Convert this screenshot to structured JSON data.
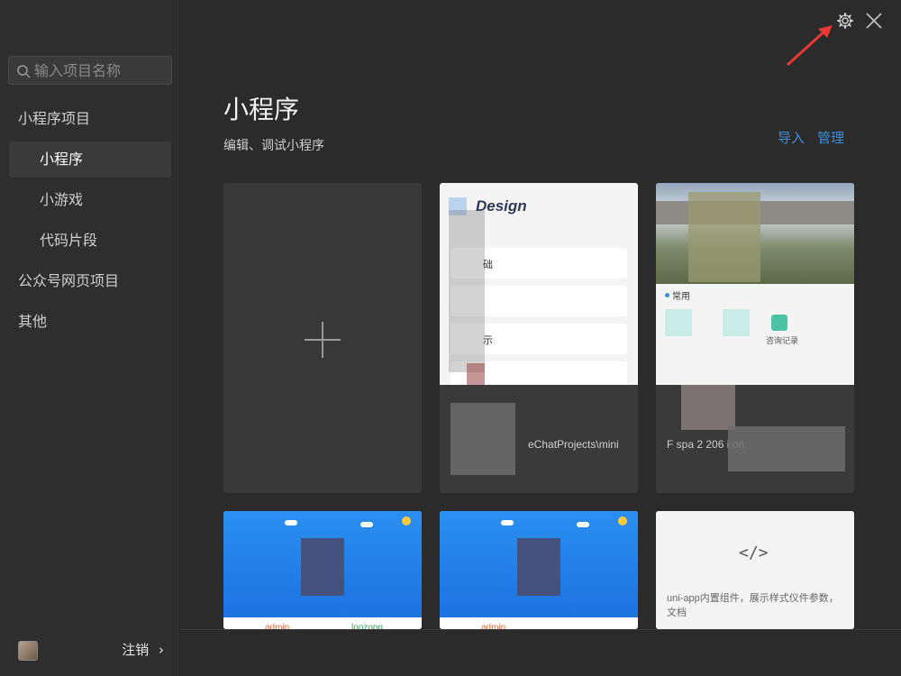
{
  "sidebar": {
    "search_placeholder": "输入项目名称",
    "items": [
      {
        "label": "小程序项目"
      },
      {
        "label": "小程序"
      },
      {
        "label": "小游戏"
      },
      {
        "label": "代码片段"
      },
      {
        "label": "公众号网页项目"
      },
      {
        "label": "其他"
      }
    ],
    "footer": {
      "logout_label": "注销",
      "chevron": "›"
    }
  },
  "main": {
    "title": "小程序",
    "subtitle": "编辑、调试小程序",
    "actions": {
      "import_label": "导入",
      "manage_label": "管理"
    },
    "projects": [
      {
        "thumb_title": "Design",
        "thumb_rows": [
          "础",
          "示"
        ],
        "name": "",
        "path": "eChatProjects\\mini"
      },
      {
        "thumb_tag": "常用",
        "thumb_action": "咨询记录",
        "name": "",
        "path": "F      spa       2  206\ni       on"
      },
      {
        "thumb_labels": [
          "admin",
          "loozong"
        ]
      },
      {
        "thumb_labels": [
          "admin"
        ]
      },
      {
        "thumb_code": "</>",
        "thumb_desc": "uni-app内置组件，展示样式仪件参数，文档"
      }
    ]
  },
  "icons": {
    "gear": "gear-icon",
    "close": "close-icon",
    "arrow": "red-arrow-annotation",
    "search": "search-icon",
    "plus": "plus-icon"
  },
  "colors": {
    "accent": "#3f8ed6",
    "annotation": "#e53935"
  }
}
